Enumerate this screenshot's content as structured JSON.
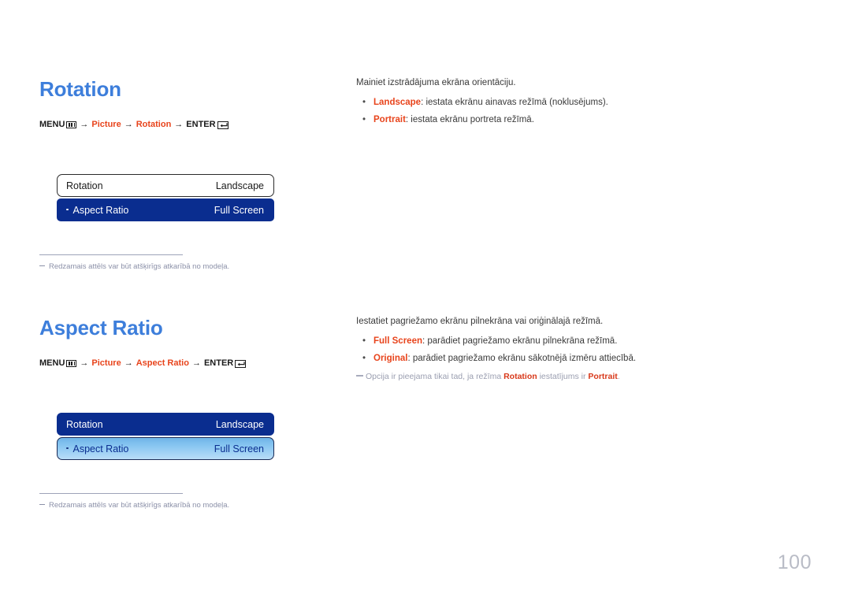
{
  "page": {
    "number": "100"
  },
  "sections": [
    {
      "id": "rotation",
      "title": "Rotation",
      "breadcrumb": {
        "menu_label": "MENU",
        "menu_icon": "menu-bars-icon",
        "arrow": "→",
        "step1": "Picture",
        "step2": "Rotation",
        "enter_label": "ENTER",
        "enter_icon": "enter-return-icon"
      },
      "osd": {
        "rows": [
          {
            "label": "Rotation",
            "value": "Landscape",
            "style": "plain",
            "bullet": false
          },
          {
            "label": "Aspect Ratio",
            "value": "Full Screen",
            "style": "navy",
            "bullet": true
          }
        ]
      },
      "footnote": "Redzamais attēls var būt atšķirīgs atkarībā no modeļa.",
      "intro": "Mainiet izstrādājuma ekrāna orientāciju.",
      "bullets": [
        {
          "term": "Landscape",
          "rest": ": iestata ekrānu ainavas režīmā (noklusējums)."
        },
        {
          "term": "Portrait",
          "rest": ": iestata ekrānu portreta režīmā."
        }
      ],
      "note": null
    },
    {
      "id": "aspect-ratio",
      "title": "Aspect Ratio",
      "breadcrumb": {
        "menu_label": "MENU",
        "menu_icon": "menu-bars-icon",
        "arrow": "→",
        "step1": "Picture",
        "step2": "Aspect Ratio",
        "enter_label": "ENTER",
        "enter_icon": "enter-return-icon"
      },
      "osd": {
        "rows": [
          {
            "label": "Rotation",
            "value": "Landscape",
            "style": "navy",
            "bullet": false
          },
          {
            "label": "Aspect Ratio",
            "value": "Full Screen",
            "style": "sel",
            "bullet": true
          }
        ]
      },
      "footnote": "Redzamais attēls var būt atšķirīgs atkarībā no modeļa.",
      "intro": "Iestatiet pagriežamo ekrānu pilnekrāna vai oriģinālajā režīmā.",
      "bullets": [
        {
          "term": "Full Screen",
          "rest": ": parādiet pagriežamo ekrānu pilnekrāna režīmā."
        },
        {
          "term": "Original",
          "rest": ": parādiet pagriežamo ekrānu sākotnējā izmēru attiecībā."
        }
      ],
      "note": {
        "pre": "Opcija ir pieejama tikai tad, ja režīma ",
        "term1": "Rotation",
        "mid": " iestatījums ir ",
        "term2": "Portrait",
        "post": "."
      }
    }
  ],
  "glyphs": {
    "bullet_dot": "•"
  }
}
